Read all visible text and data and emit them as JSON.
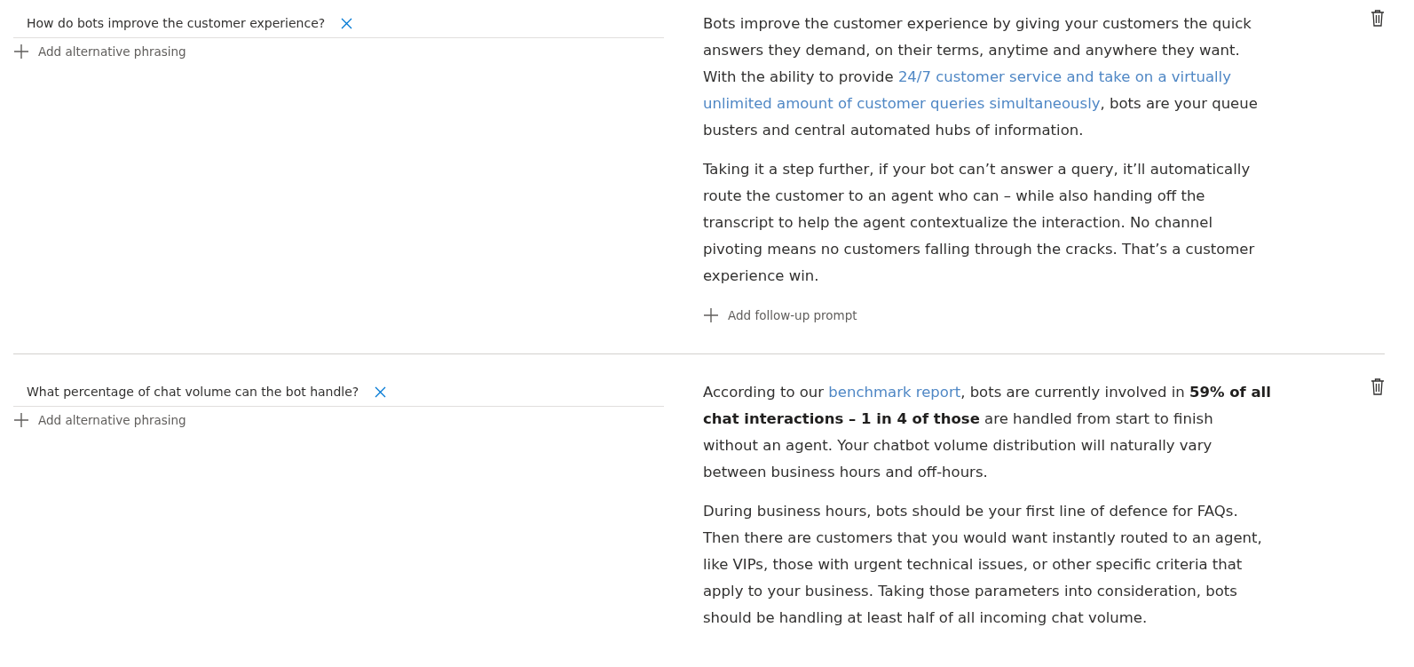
{
  "qna_pairs": [
    {
      "question": "How do bots improve the customer experience?",
      "add_phrasing": "Add alternative phrasing",
      "answer": [
        [
          {
            "kind": "text",
            "text": "Bots improve the customer experience by giving your customers the quick answers they demand, on their terms, anytime and anywhere they want. With the ability to provide "
          },
          {
            "kind": "link",
            "text": "24/7 customer service and take on a virtually"
          },
          {
            "kind": "link",
            "text": "unlimited amount of customer queries simultaneously"
          },
          {
            "kind": "text",
            "text": ", bots are your queue busters and central automated hubs of information."
          }
        ],
        [
          {
            "kind": "text",
            "text": "Taking it a step further, if your bot can’t answer a query, it’ll automatically route the customer to an agent who can – while also handing off the transcript to help the agent contextualize the interaction. No channel pivoting means no customers falling through the cracks. That’s a customer experience win."
          }
        ]
      ],
      "follow_up": "Add follow-up prompt"
    },
    {
      "question": "What percentage of chat volume can the bot handle?",
      "add_phrasing": "Add alternative phrasing",
      "answer": [
        [
          {
            "kind": "text",
            "text": "According to our "
          },
          {
            "kind": "link",
            "text": "benchmark report"
          },
          {
            "kind": "text",
            "text": ", bots are currently involved in **59% of all chat interactions – 1 in 4 of those** are handled from start to finish without an agent. Your chatbot volume distribution will naturally vary between business hours and off-hours."
          }
        ],
        [
          {
            "kind": "text",
            "text": "During business hours, bots should be your first line of defence for FAQs. Then there are customers that you would want instantly routed to an agent, like VIPs, those with urgent technical issues, or other specific criteria that apply to your business. Taking those parameters into consideration, bots should be handling at least half of all incoming chat volume."
          }
        ]
      ]
    }
  ]
}
